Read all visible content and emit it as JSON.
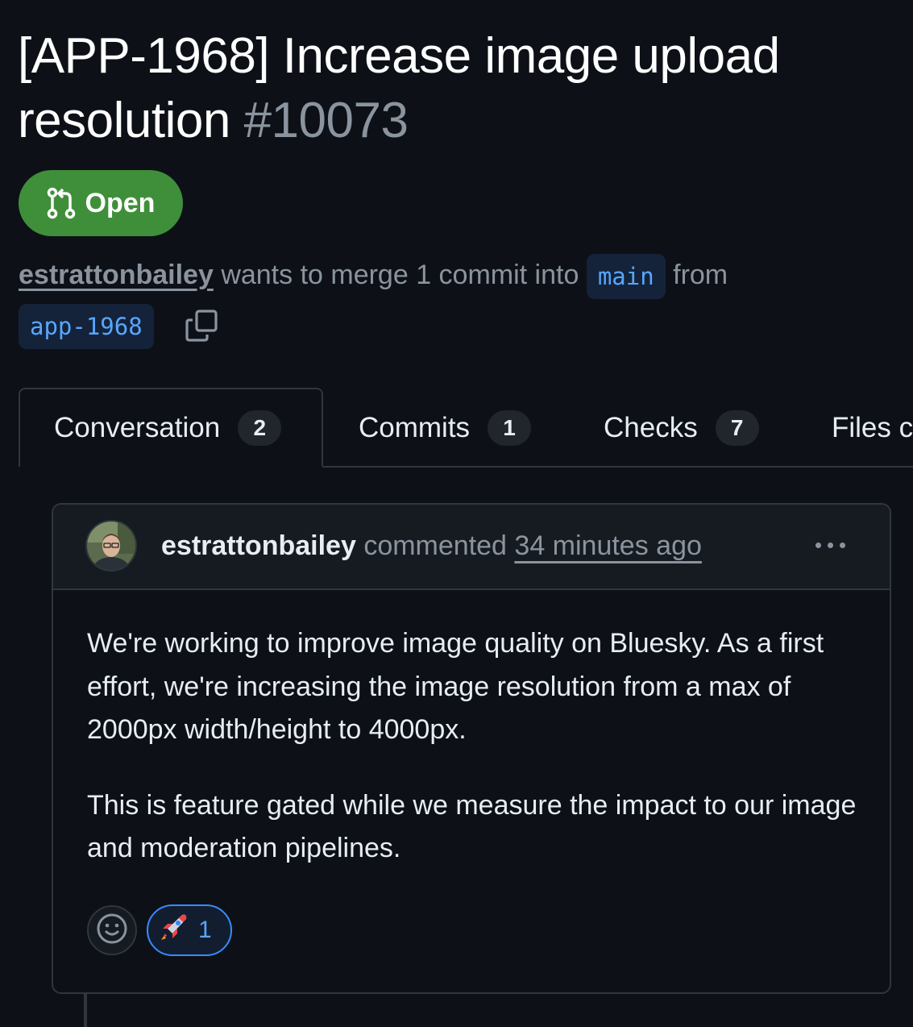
{
  "pr": {
    "title": "[APP-1968] Increase image upload resolution",
    "number": "#10073",
    "state": "Open",
    "state_icon": "git-pull-request-icon",
    "author": "estrattonbailey",
    "merge_text": "wants to merge 1 commit into",
    "base_branch": "main",
    "from_text": "from",
    "head_branch": "app-1968"
  },
  "tabs": [
    {
      "label": "Conversation",
      "count": "2"
    },
    {
      "label": "Commits",
      "count": "1"
    },
    {
      "label": "Checks",
      "count": "7"
    },
    {
      "label": "Files c"
    }
  ],
  "comment": {
    "author": "estrattonbailey",
    "action": "commented",
    "time": "34 minutes ago",
    "paragraphs": [
      "We're working to improve image quality on Bluesky. As a first effort, we're increasing the image resolution from a max of 2000px width/height to 4000px.",
      "This is feature gated while we measure the impact to our image and moderation pipelines."
    ],
    "reactions": [
      {
        "emoji": "🚀",
        "count": "1"
      }
    ]
  },
  "colors": {
    "background": "#0d1117",
    "open_badge": "#3f8f3a",
    "link_blue": "#58a6ff",
    "muted": "#8b949e",
    "border": "#30363d"
  }
}
